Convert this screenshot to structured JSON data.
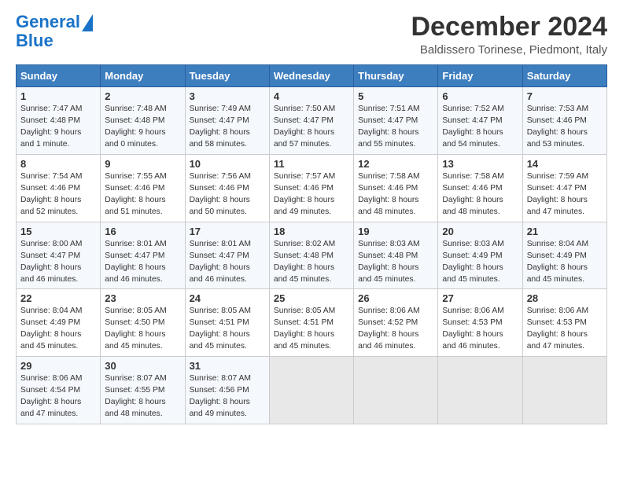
{
  "logo": {
    "line1": "General",
    "line2": "Blue"
  },
  "title": "December 2024",
  "location": "Baldissero Torinese, Piedmont, Italy",
  "weekdays": [
    "Sunday",
    "Monday",
    "Tuesday",
    "Wednesday",
    "Thursday",
    "Friday",
    "Saturday"
  ],
  "weeks": [
    [
      {
        "day": "1",
        "rise": "Sunrise: 7:47 AM",
        "set": "Sunset: 4:48 PM",
        "light": "Daylight: 9 hours and 1 minute."
      },
      {
        "day": "2",
        "rise": "Sunrise: 7:48 AM",
        "set": "Sunset: 4:48 PM",
        "light": "Daylight: 9 hours and 0 minutes."
      },
      {
        "day": "3",
        "rise": "Sunrise: 7:49 AM",
        "set": "Sunset: 4:47 PM",
        "light": "Daylight: 8 hours and 58 minutes."
      },
      {
        "day": "4",
        "rise": "Sunrise: 7:50 AM",
        "set": "Sunset: 4:47 PM",
        "light": "Daylight: 8 hours and 57 minutes."
      },
      {
        "day": "5",
        "rise": "Sunrise: 7:51 AM",
        "set": "Sunset: 4:47 PM",
        "light": "Daylight: 8 hours and 55 minutes."
      },
      {
        "day": "6",
        "rise": "Sunrise: 7:52 AM",
        "set": "Sunset: 4:47 PM",
        "light": "Daylight: 8 hours and 54 minutes."
      },
      {
        "day": "7",
        "rise": "Sunrise: 7:53 AM",
        "set": "Sunset: 4:46 PM",
        "light": "Daylight: 8 hours and 53 minutes."
      }
    ],
    [
      {
        "day": "8",
        "rise": "Sunrise: 7:54 AM",
        "set": "Sunset: 4:46 PM",
        "light": "Daylight: 8 hours and 52 minutes."
      },
      {
        "day": "9",
        "rise": "Sunrise: 7:55 AM",
        "set": "Sunset: 4:46 PM",
        "light": "Daylight: 8 hours and 51 minutes."
      },
      {
        "day": "10",
        "rise": "Sunrise: 7:56 AM",
        "set": "Sunset: 4:46 PM",
        "light": "Daylight: 8 hours and 50 minutes."
      },
      {
        "day": "11",
        "rise": "Sunrise: 7:57 AM",
        "set": "Sunset: 4:46 PM",
        "light": "Daylight: 8 hours and 49 minutes."
      },
      {
        "day": "12",
        "rise": "Sunrise: 7:58 AM",
        "set": "Sunset: 4:46 PM",
        "light": "Daylight: 8 hours and 48 minutes."
      },
      {
        "day": "13",
        "rise": "Sunrise: 7:58 AM",
        "set": "Sunset: 4:46 PM",
        "light": "Daylight: 8 hours and 48 minutes."
      },
      {
        "day": "14",
        "rise": "Sunrise: 7:59 AM",
        "set": "Sunset: 4:47 PM",
        "light": "Daylight: 8 hours and 47 minutes."
      }
    ],
    [
      {
        "day": "15",
        "rise": "Sunrise: 8:00 AM",
        "set": "Sunset: 4:47 PM",
        "light": "Daylight: 8 hours and 46 minutes."
      },
      {
        "day": "16",
        "rise": "Sunrise: 8:01 AM",
        "set": "Sunset: 4:47 PM",
        "light": "Daylight: 8 hours and 46 minutes."
      },
      {
        "day": "17",
        "rise": "Sunrise: 8:01 AM",
        "set": "Sunset: 4:47 PM",
        "light": "Daylight: 8 hours and 46 minutes."
      },
      {
        "day": "18",
        "rise": "Sunrise: 8:02 AM",
        "set": "Sunset: 4:48 PM",
        "light": "Daylight: 8 hours and 45 minutes."
      },
      {
        "day": "19",
        "rise": "Sunrise: 8:03 AM",
        "set": "Sunset: 4:48 PM",
        "light": "Daylight: 8 hours and 45 minutes."
      },
      {
        "day": "20",
        "rise": "Sunrise: 8:03 AM",
        "set": "Sunset: 4:49 PM",
        "light": "Daylight: 8 hours and 45 minutes."
      },
      {
        "day": "21",
        "rise": "Sunrise: 8:04 AM",
        "set": "Sunset: 4:49 PM",
        "light": "Daylight: 8 hours and 45 minutes."
      }
    ],
    [
      {
        "day": "22",
        "rise": "Sunrise: 8:04 AM",
        "set": "Sunset: 4:49 PM",
        "light": "Daylight: 8 hours and 45 minutes."
      },
      {
        "day": "23",
        "rise": "Sunrise: 8:05 AM",
        "set": "Sunset: 4:50 PM",
        "light": "Daylight: 8 hours and 45 minutes."
      },
      {
        "day": "24",
        "rise": "Sunrise: 8:05 AM",
        "set": "Sunset: 4:51 PM",
        "light": "Daylight: 8 hours and 45 minutes."
      },
      {
        "day": "25",
        "rise": "Sunrise: 8:05 AM",
        "set": "Sunset: 4:51 PM",
        "light": "Daylight: 8 hours and 45 minutes."
      },
      {
        "day": "26",
        "rise": "Sunrise: 8:06 AM",
        "set": "Sunset: 4:52 PM",
        "light": "Daylight: 8 hours and 46 minutes."
      },
      {
        "day": "27",
        "rise": "Sunrise: 8:06 AM",
        "set": "Sunset: 4:53 PM",
        "light": "Daylight: 8 hours and 46 minutes."
      },
      {
        "day": "28",
        "rise": "Sunrise: 8:06 AM",
        "set": "Sunset: 4:53 PM",
        "light": "Daylight: 8 hours and 47 minutes."
      }
    ],
    [
      {
        "day": "29",
        "rise": "Sunrise: 8:06 AM",
        "set": "Sunset: 4:54 PM",
        "light": "Daylight: 8 hours and 47 minutes."
      },
      {
        "day": "30",
        "rise": "Sunrise: 8:07 AM",
        "set": "Sunset: 4:55 PM",
        "light": "Daylight: 8 hours and 48 minutes."
      },
      {
        "day": "31",
        "rise": "Sunrise: 8:07 AM",
        "set": "Sunset: 4:56 PM",
        "light": "Daylight: 8 hours and 49 minutes."
      },
      null,
      null,
      null,
      null
    ]
  ]
}
